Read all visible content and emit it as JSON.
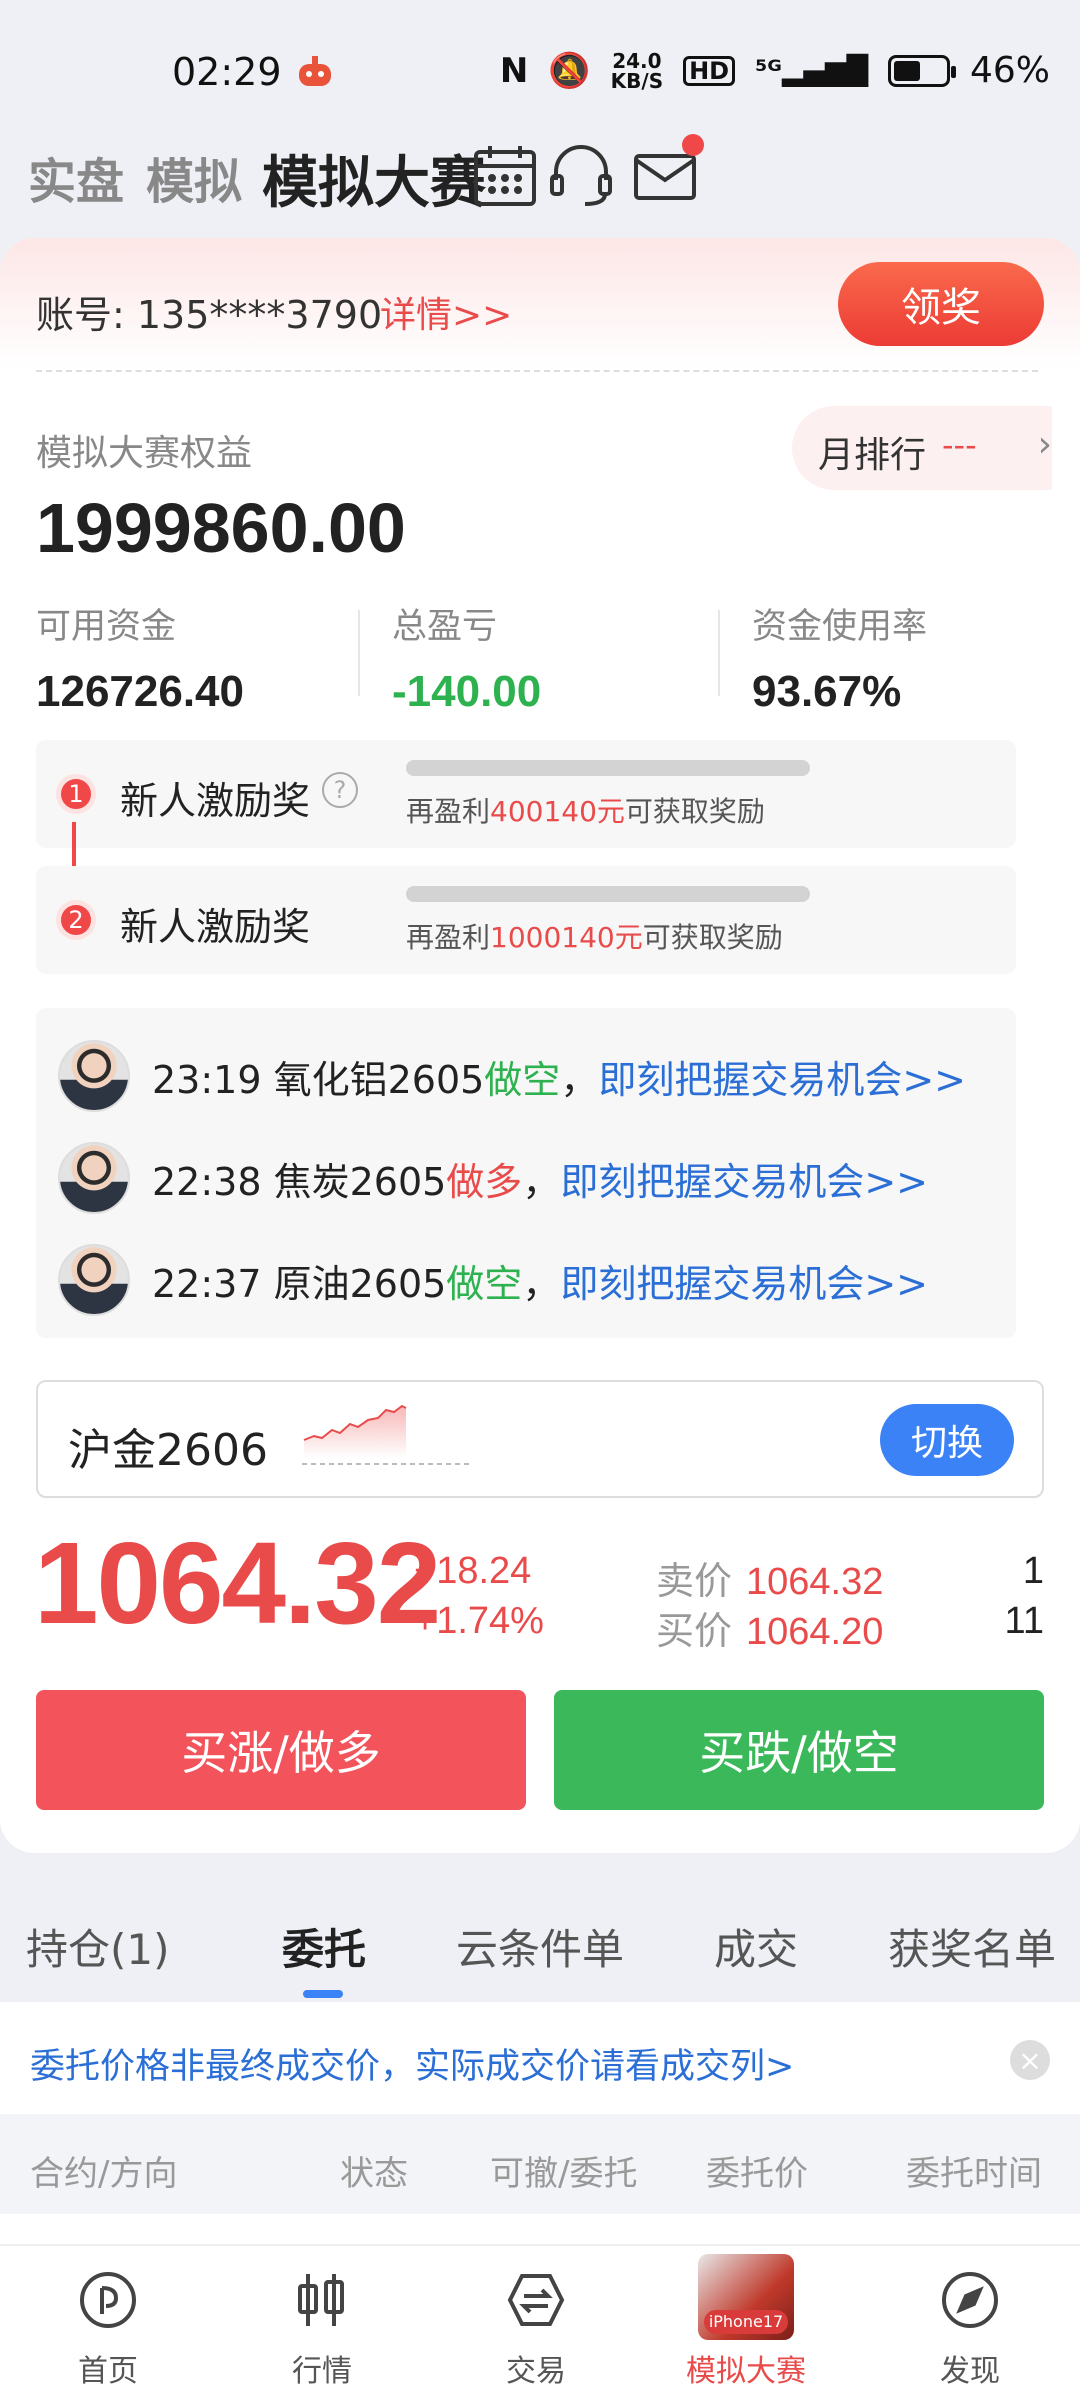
{
  "status_bar": {
    "time": "02:29",
    "net_speed_top": "24.0",
    "net_speed_unit": "KB/S",
    "battery": "46%"
  },
  "top_nav": {
    "tabs": [
      "实盘",
      "模拟",
      "模拟大赛"
    ]
  },
  "account": {
    "text": "账号: 135****3790",
    "detail_link": "详情>>",
    "award_button": "领奖"
  },
  "equity": {
    "label": "模拟大赛权益",
    "value": "1999860.00",
    "rank_label": "月排行",
    "rank_value": "---"
  },
  "stats": [
    {
      "label": "可用资金",
      "value": "126726.40"
    },
    {
      "label": "总盈亏",
      "value": "-140.00"
    },
    {
      "label": "资金使用率",
      "value": "93.67%"
    }
  ],
  "rewards": [
    {
      "num": "1",
      "title": "新人激励奖",
      "hint_pre": "再盈利",
      "amount": "400140元",
      "hint_post": "可获取奖励",
      "progress": 0
    },
    {
      "num": "2",
      "title": "新人激励奖",
      "hint_pre": "再盈利",
      "amount": "1000140元",
      "hint_post": "可获取奖励",
      "progress": 0
    }
  ],
  "feed": [
    {
      "time_product": "23:19 氧化铝2605",
      "action": "做空",
      "link": "即刻把握交易机会>>"
    },
    {
      "time_product": "22:38 焦炭2605",
      "action": "做多",
      "link": "即刻把握交易机会>>"
    },
    {
      "time_product": "22:37 原油2605",
      "action": "做空",
      "link": "即刻把握交易机会>>"
    }
  ],
  "contract": {
    "name": "沪金2606",
    "switch_label": "切换"
  },
  "quote": {
    "price": "1064.32",
    "change": "+18.24",
    "change_pct": "+1.74%",
    "ask_label": "卖价",
    "ask": "1064.32",
    "ask_qty": "1",
    "bid_label": "买价",
    "bid": "1064.20",
    "bid_qty": "11"
  },
  "actions": {
    "buy_up": "买涨/做多",
    "buy_down": "买跌/做空"
  },
  "lower_tabs": [
    "持仓(1)",
    "委托",
    "云条件单",
    "成交",
    "获奖名单"
  ],
  "notice": "委托价格非最终成交价，实际成交价请看成交列>",
  "table_headers": [
    "合约/方向",
    "状态",
    "可撤/委托",
    "委托价",
    "委托时间"
  ],
  "bottom_nav": [
    {
      "label": "首页",
      "icon": "home-icon"
    },
    {
      "label": "行情",
      "icon": "candlestick-icon"
    },
    {
      "label": "交易",
      "icon": "trade-icon"
    },
    {
      "label": "模拟大赛",
      "icon": "iphone-promo-icon",
      "badge": "iPhone17"
    },
    {
      "label": "发现",
      "icon": "compass-icon"
    }
  ],
  "colors": {
    "red": "#e94b4b",
    "green": "#2eb24f",
    "blue": "#2b6fd6",
    "accent_blue": "#3b82f6"
  }
}
